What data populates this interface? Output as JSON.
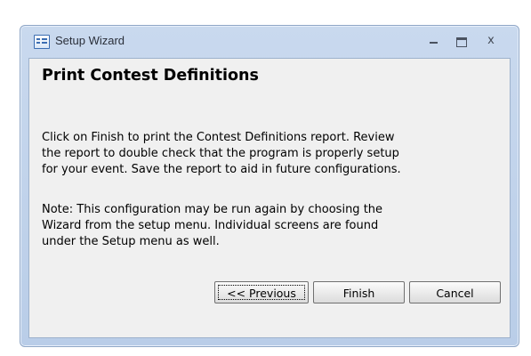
{
  "window": {
    "title": "Setup Wizard",
    "controls": {
      "minimize": "minimize",
      "maximize": "maximize",
      "close": "x"
    }
  },
  "page": {
    "heading": "Print Contest Definitions",
    "paragraph1": "Click on Finish to print the Contest Definitions report.  Review\nthe report to double check that the program is properly setup\nfor your event.  Save the report to aid in future configurations.",
    "paragraph2": "Note:  This configuration may be run again by choosing the\nWizard from the setup menu.  Individual screens are found\nunder the Setup menu as well."
  },
  "buttons": {
    "previous": "<< Previous",
    "finish": "Finish",
    "cancel": "Cancel"
  },
  "icons": {
    "app": "form-icon",
    "minimize": "minimize-icon",
    "maximize": "maximize-icon",
    "close": "close-icon"
  }
}
